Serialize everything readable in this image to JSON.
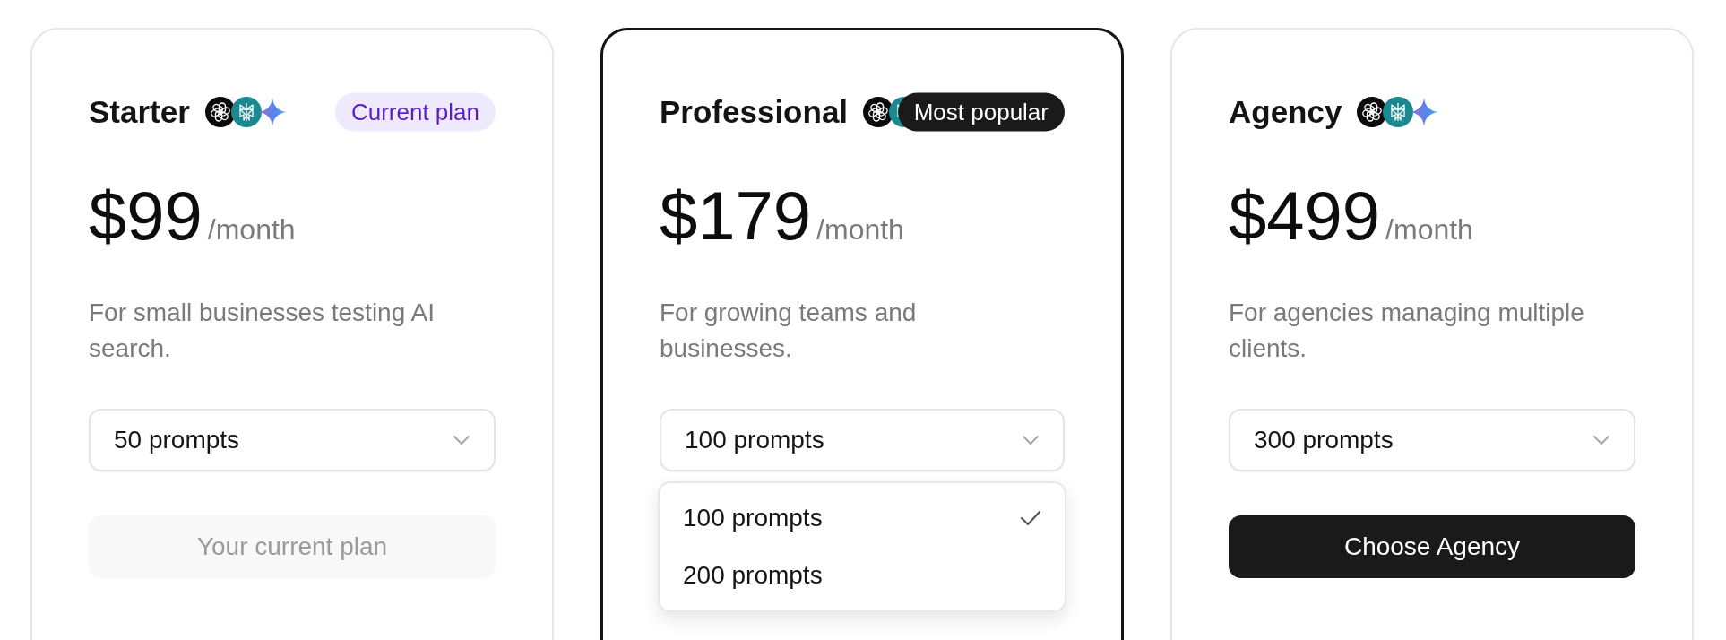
{
  "plans": [
    {
      "title": "Starter",
      "featured": false,
      "badge": {
        "kind": "current",
        "label": "Current plan"
      },
      "price": "$99",
      "period": "/month",
      "description": "For small businesses testing AI search.",
      "select": {
        "value": "50 prompts"
      },
      "button": {
        "label": "Your current plan",
        "disabled": true
      }
    },
    {
      "title": "Professional",
      "featured": true,
      "badge": {
        "kind": "popular",
        "label": "Most popular"
      },
      "price": "$179",
      "period": "/month",
      "description": "For growing teams and businesses.",
      "select": {
        "value": "100 prompts",
        "menu": [
          {
            "label": "100 prompts",
            "selected": true
          },
          {
            "label": "200 prompts",
            "selected": false
          }
        ]
      }
    },
    {
      "title": "Agency",
      "featured": false,
      "price": "$499",
      "period": "/month",
      "description": "For agencies managing multiple clients.",
      "select": {
        "value": "300 prompts"
      },
      "button": {
        "label": "Choose Agency",
        "disabled": false
      }
    }
  ]
}
